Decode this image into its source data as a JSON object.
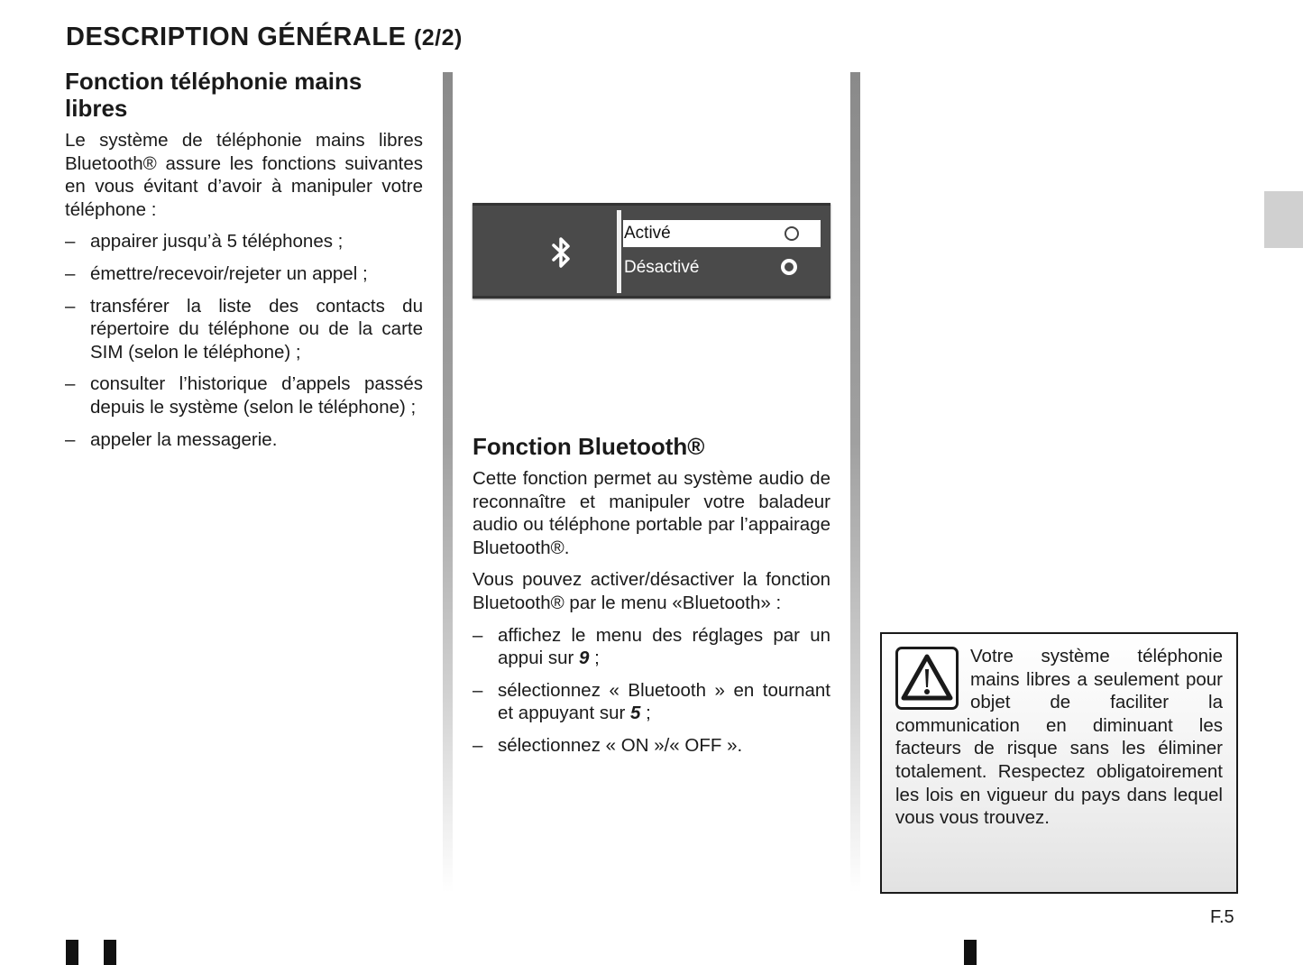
{
  "page": {
    "title": "DESCRIPTION GÉNÉRALE",
    "title_suffix": "(2/2)",
    "page_number": "F.5"
  },
  "left_column": {
    "heading": "Fonction téléphonie mains libres",
    "intro": "Le système de téléphonie mains libres Bluetooth® assure les fonctions suivantes en vous évitant d’avoir à manipuler votre téléphone :",
    "items": [
      "appairer jusqu’à 5 téléphones ;",
      "émettre/recevoir/rejeter un appel ;",
      "transférer la liste des contacts du répertoire du téléphone ou de la carte SIM (selon le téléphone) ;",
      "consulter l’historique d’appels passés depuis le système (selon le téléphone) ;",
      "appeler la messagerie."
    ]
  },
  "bluetooth_screen": {
    "icon": "bluetooth-icon",
    "options": [
      {
        "label": "Activé",
        "selected": true
      },
      {
        "label": "Désactivé",
        "selected": false
      }
    ]
  },
  "middle_column": {
    "heading": "Fonction Bluetooth®",
    "paragraphs": [
      "Cette fonction permet au système audio de reconnaître et manipuler votre baladeur audio ou téléphone portable par l’appairage Bluetooth®.",
      "Vous pouvez activer/désactiver la fonction Bluetooth® par le menu «Bluetooth» :"
    ],
    "steps": [
      {
        "before": "affichez le menu des réglages par un appui sur ",
        "key": "9",
        "after": " ;"
      },
      {
        "before": "sélectionnez « Bluetooth » en tournant et appuyant sur ",
        "key": "5",
        "after": " ;"
      },
      {
        "before": "sélectionnez « ON »/« OFF ».",
        "key": "",
        "after": ""
      }
    ]
  },
  "warning": {
    "icon": "warning-icon",
    "text": "Votre système téléphonie mains libres a seulement pour objet de faciliter la communication en diminuant les facteurs de risque sans les éliminer totalement. Respectez obligatoirement les lois en vigueur du pays dans lequel vous vous trouvez."
  }
}
